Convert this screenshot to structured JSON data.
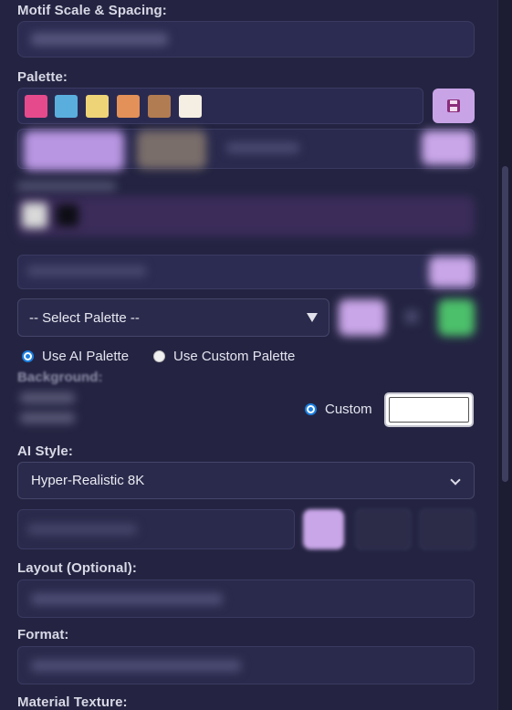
{
  "labels": {
    "motif_scale": "Motif Scale & Spacing:",
    "palette": "Palette:",
    "background": "Background:",
    "ai_style": "AI Style:",
    "layout": "Layout (Optional):",
    "format": "Format:",
    "material_texture": "Material Texture:"
  },
  "palette": {
    "swatches": [
      "#e54b8c",
      "#5aaede",
      "#eed477",
      "#e39158",
      "#b27c52",
      "#f5efe3"
    ],
    "save_icon": "floppy-disk-icon"
  },
  "palette_select": {
    "selected": "-- Select Palette --",
    "arrow_icon": "caret-down-icon"
  },
  "palette_mode": {
    "ai_label": "Use AI Palette",
    "custom_label": "Use Custom Palette",
    "selected": "ai"
  },
  "background": {
    "custom_label": "Custom",
    "custom_color": "#ffffff"
  },
  "ai_style": {
    "selected": "Hyper-Realistic 8K"
  },
  "colors": {
    "accent": "#c8a4e6",
    "panel": "#242442",
    "field": "#2c2c52",
    "radio_blue": "#1b7fe0",
    "green": "#4cc06a"
  }
}
